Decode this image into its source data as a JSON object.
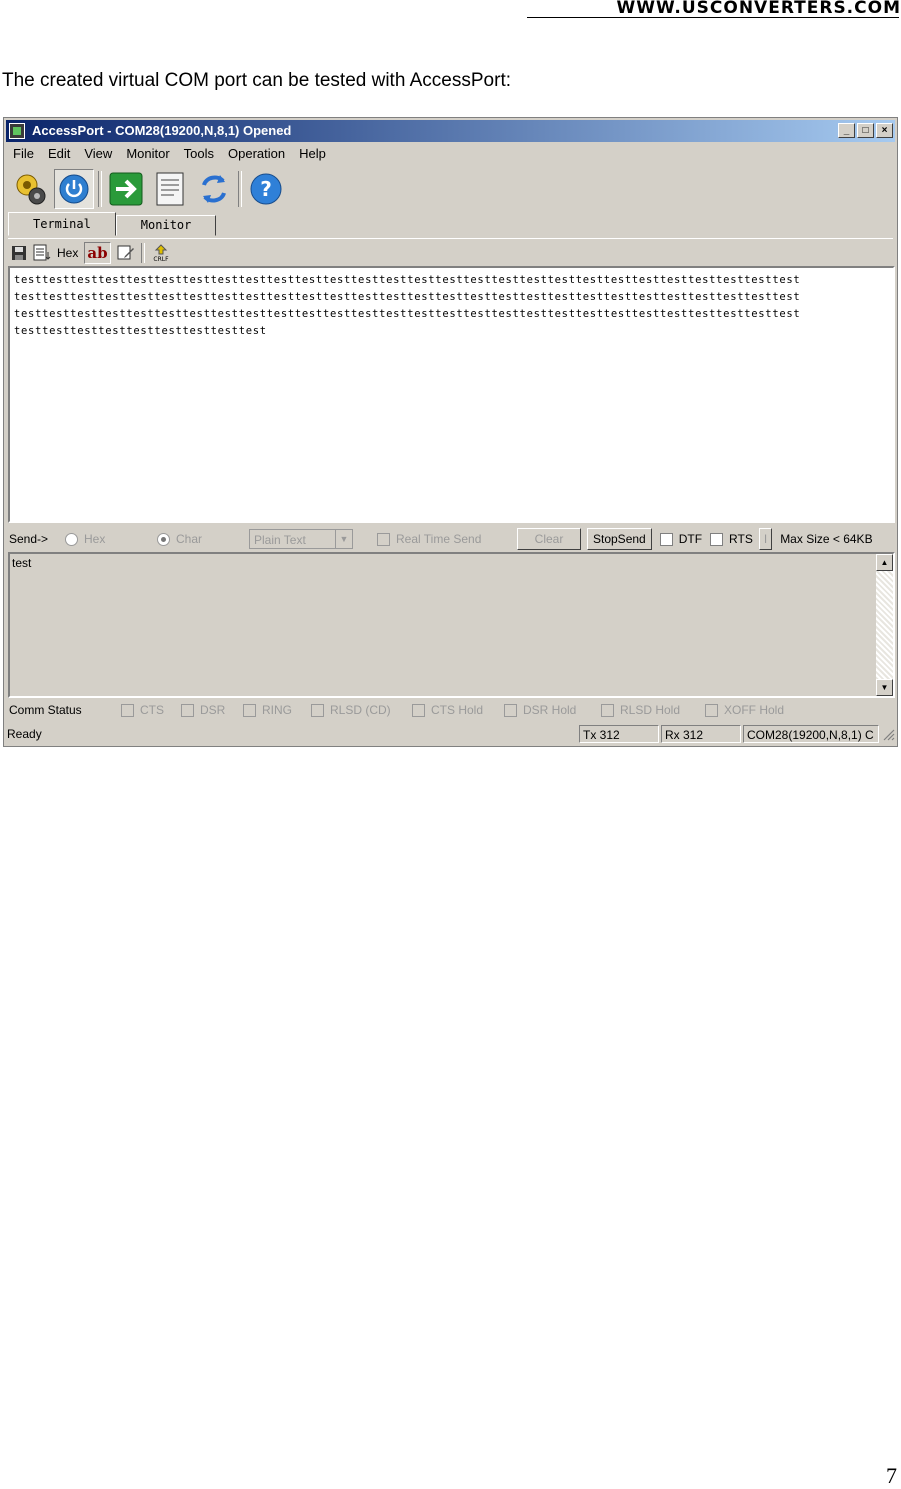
{
  "header": {
    "url": "WWW.USCONVERTERS.COM"
  },
  "intro_text": "The created virtual COM port can be tested with AccessPort:",
  "window": {
    "title": "AccessPort - COM28(19200,N,8,1) Opened",
    "menu": [
      "File",
      "Edit",
      "View",
      "Monitor",
      "Tools",
      "Operation",
      "Help"
    ],
    "toolbar_icons": [
      "gears-icon",
      "power-icon",
      "arrow-right-icon",
      "document-icon",
      "refresh-icon",
      "help-icon"
    ],
    "tabs": [
      "Terminal",
      "Monitor"
    ],
    "subtoolbar": {
      "hex_label": "Hex",
      "ab_label": "ab"
    },
    "terminal_lines": [
      "testtesttesttesttesttesttesttesttesttesttesttesttesttesttesttesttesttesttesttesttesttesttesttesttesttesttesttest",
      "testtesttesttesttesttesttesttesttesttesttesttesttesttesttesttesttesttesttesttesttesttesttesttesttesttesttesttest",
      "testtesttesttesttesttesttesttesttesttesttesttesttesttesttesttesttesttesttesttesttesttesttesttesttesttesttesttest",
      "testtesttesttesttesttesttesttesttest"
    ],
    "sendbar": {
      "label": "Send->",
      "hex": "Hex",
      "char": "Char",
      "format": "Plain Text",
      "realtime": "Real Time Send",
      "clear": "Clear",
      "stopsend": "StopSend",
      "dtf": "DTF",
      "rts": "RTS",
      "sep": "I",
      "maxsize": "Max Size < 64KB"
    },
    "send_text": "test",
    "comm": {
      "label": "Comm Status",
      "items": [
        "CTS",
        "DSR",
        "RING",
        "RLSD (CD)",
        "CTS Hold",
        "DSR Hold",
        "RLSD Hold",
        "XOFF Hold"
      ]
    },
    "status": {
      "ready": "Ready",
      "tx": "Tx 312",
      "rx": "Rx 312",
      "port": "COM28(19200,N,8,1) C"
    }
  },
  "page_number": "7"
}
